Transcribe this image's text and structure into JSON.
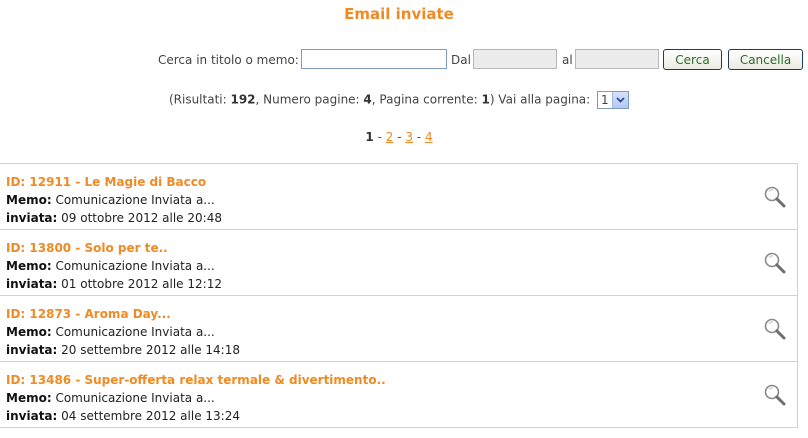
{
  "page": {
    "title": "Email inviate"
  },
  "search": {
    "label": "Cerca in titolo o memo:",
    "value": "",
    "from_label": "Dal",
    "from_value": "",
    "to_label": "al",
    "to_value": "",
    "search_button": "Cerca",
    "clear_button": "Cancella"
  },
  "info": {
    "prefix": "(Risultati: ",
    "results": "192",
    "pages_label": ", Numero pagine: ",
    "pages": "4",
    "current_label": ", Pagina corrente: ",
    "current": "1",
    "suffix": ") Vai alla pagina:",
    "goto_value": "1"
  },
  "pagination": {
    "current": "1",
    "sep": " - ",
    "links": [
      "2",
      "3",
      "4"
    ]
  },
  "emails": [
    {
      "title": "ID: 12911 - Le Magie di Bacco",
      "memo_label": "Memo:",
      "memo": " Comunicazione Inviata a...",
      "sent_label": "inviata:",
      "sent": " 09 ottobre 2012 alle 20:48"
    },
    {
      "title": "ID: 13800 - Solo per te..",
      "memo_label": "Memo:",
      "memo": " Comunicazione Inviata a...",
      "sent_label": "inviata:",
      "sent": " 01 ottobre 2012 alle 12:12"
    },
    {
      "title": "ID: 12873 - Aroma Day...",
      "memo_label": "Memo:",
      "memo": " Comunicazione Inviata a...",
      "sent_label": "inviata:",
      "sent": " 20 settembre 2012 alle 14:18"
    },
    {
      "title": "ID: 13486 - Super-offerta relax termale & divertimento..",
      "memo_label": "Memo:",
      "memo": " Comunicazione Inviata a...",
      "sent_label": "inviata:",
      "sent": " 04 settembre 2012 alle 13:24"
    }
  ],
  "colors": {
    "accent": "#f08a24",
    "border": "#f5c89a"
  },
  "icons": {
    "item_action": "magnifier-icon",
    "dropdown": "chevron-down-icon"
  }
}
